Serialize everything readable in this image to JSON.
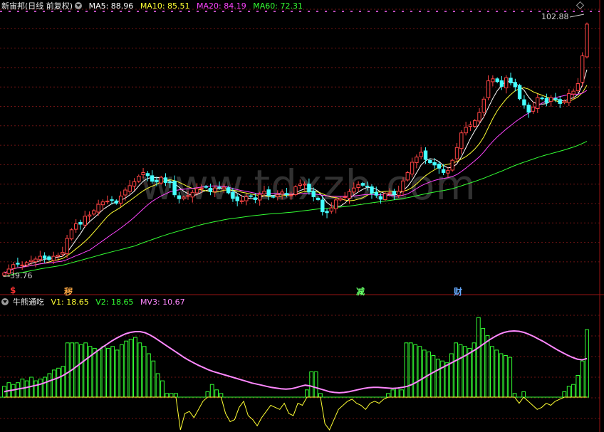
{
  "upper_header": {
    "title": "新宙邦(日线 前复权)",
    "ma_items": [
      {
        "label": "MA5: 88.96",
        "color": "#ffffff"
      },
      {
        "label": "MA10: 85.51",
        "color": "#ffff33"
      },
      {
        "label": "MA20: 84.19",
        "color": "#ff44ff"
      },
      {
        "label": "MA60: 72.31",
        "color": "#33ff33"
      }
    ]
  },
  "lower_header": {
    "title": "牛熊通吃",
    "items": [
      {
        "label": "V1: 18.65",
        "color": "#ffff33"
      },
      {
        "label": "V2: 18.65",
        "color": "#33ff33"
      },
      {
        "label": "MV3: 10.67",
        "color": "#ff88ff"
      }
    ]
  },
  "price_labels": {
    "high": "102.88",
    "low": "39.76"
  },
  "signals": [
    {
      "text": "$",
      "color": "#ff3333"
    },
    {
      "text": "秽",
      "color": "#ffaa44"
    },
    {
      "text": "减",
      "color": "#66ff66"
    },
    {
      "text": "财",
      "color": "#66aaff"
    }
  ],
  "watermark": "www.tdxzb.com",
  "chart_data": [
    {
      "type": "candlestick",
      "title": "新宙邦(日线 前复权)",
      "price_range": [
        39.76,
        102.88
      ],
      "closes": [
        40.2,
        41.2,
        42.3,
        42.4,
        42.2,
        42.8,
        43.4,
        43.7,
        44.4,
        43.9,
        43.6,
        44.4,
        44.7,
        45.4,
        48.9,
        51.1,
        52.6,
        52.5,
        54.5,
        54.8,
        55.9,
        57.5,
        58.1,
        58.3,
        58.6,
        57.8,
        59.6,
        61.1,
        62.2,
        63.2,
        64.6,
        65.5,
        64.7,
        63.3,
        63.2,
        64.3,
        63.0,
        63.0,
        59.9,
        58.9,
        59.3,
        59.7,
        60.5,
        61.4,
        61.6,
        61.8,
        60.7,
        61.6,
        61.8,
        61.8,
        60.4,
        59.0,
        58.4,
        58.4,
        59.4,
        59.5,
        58.7,
        60.0,
        60.8,
        59.7,
        59.4,
        59.9,
        60.6,
        59.9,
        59.8,
        61.9,
        62.6,
        62.6,
        60.6,
        59.4,
        58.7,
        55.6,
        55.4,
        56.6,
        58.6,
        59.0,
        59.4,
        60.7,
        61.6,
        62.4,
        62.3,
        61.9,
        60.3,
        59.8,
        58.8,
        60.2,
        60.4,
        60.0,
        60.8,
        63.4,
        65.5,
        68.1,
        69.4,
        70.6,
        68.8,
        68.0,
        67.4,
        66.6,
        65.5,
        66.0,
        68.6,
        71.8,
        75.5,
        76.9,
        77.5,
        78.6,
        80.6,
        84.0,
        88.6,
        89.1,
        88.4,
        87.2,
        89.4,
        88.1,
        87.1,
        84.1,
        82.5,
        80.7,
        82.0,
        84.4,
        84.1,
        83.1,
        84.4,
        83.9,
        82.9,
        83.5,
        85.4,
        86.0,
        87.9,
        94.9,
        102.9
      ],
      "ma": [
        {
          "name": "MA5",
          "value": 88.96
        },
        {
          "name": "MA10",
          "value": 85.51
        },
        {
          "name": "MA20",
          "value": 84.19
        },
        {
          "name": "MA60",
          "value": 72.31
        }
      ]
    },
    {
      "type": "bar+line",
      "title": "牛熊通吃",
      "y_range": [
        -8,
        24
      ],
      "bars": [
        3.0,
        4.0,
        3.5,
        4.0,
        5.0,
        4.5,
        5.5,
        4.5,
        5.0,
        5.5,
        6.5,
        7.5,
        8.0,
        8.5,
        15.0,
        15.0,
        15.0,
        14.5,
        15.0,
        14.0,
        13.5,
        13.0,
        14.0,
        13.5,
        14.0,
        13.0,
        14.5,
        15.5,
        16.0,
        16.5,
        15.0,
        14.0,
        12.0,
        10.0,
        6.5,
        4.5,
        1.0,
        1.0,
        1.0,
        -8.0,
        -4.0,
        -3.5,
        -5.0,
        -3.0,
        -1.0,
        1.5,
        3.5,
        2.0,
        1.0,
        -4.0,
        -6.0,
        -5.5,
        -2.5,
        -1.0,
        -4.5,
        -5.5,
        -7.0,
        -5.0,
        -3.5,
        -2.0,
        -2.5,
        -3.0,
        -1.5,
        -4.0,
        -4.5,
        -1.5,
        -2.0,
        2.0,
        7.0,
        7.0,
        1.0,
        -6.5,
        -8.0,
        -5.5,
        -3.0,
        -2.0,
        -1.0,
        -0.5,
        -1.5,
        -2.0,
        -3.0,
        -1.5,
        -1.0,
        -1.5,
        -0.5,
        1.0,
        2.0,
        2.5,
        2.0,
        15.0,
        15.0,
        14.5,
        14.0,
        13.0,
        12.5,
        11.5,
        10.5,
        10.0,
        9.5,
        12.0,
        15.0,
        14.5,
        14.0,
        13.5,
        15.0,
        22.0,
        19.0,
        17.0,
        14.0,
        13.0,
        12.0,
        11.5,
        11.0,
        1.0,
        -1.5,
        1.5,
        -1.0,
        -2.0,
        -3.0,
        -2.5,
        -1.5,
        -2.0,
        -1.0,
        -0.5,
        1.5,
        3.0,
        3.5,
        6.0,
        10.0,
        18.65
      ],
      "mv3": [
        1.5,
        1.8,
        2.0,
        2.3,
        2.5,
        2.8,
        3.1,
        3.4,
        3.8,
        4.3,
        4.8,
        5.3,
        5.9,
        6.7,
        7.6,
        8.6,
        9.6,
        10.6,
        11.6,
        12.6,
        13.6,
        14.5,
        15.4,
        16.2,
        16.9,
        17.5,
        17.9,
        18.1,
        18.1,
        17.8,
        17.2,
        16.4,
        15.5,
        14.6,
        13.7,
        12.8,
        11.9,
        11.0,
        10.2,
        9.5,
        8.8,
        8.2,
        7.6,
        7.1,
        6.7,
        6.3,
        5.9,
        5.5,
        5.1,
        4.7,
        4.3,
        3.9,
        3.6,
        3.3,
        3.0,
        2.7,
        2.5,
        2.3,
        2.2,
        2.3,
        2.6,
        3.0,
        3.3,
        3.1,
        2.7,
        2.3,
        1.9,
        1.5,
        1.3,
        1.2,
        1.3,
        1.5,
        1.8,
        2.1,
        2.4,
        2.6,
        2.7,
        2.7,
        2.6,
        2.5,
        2.4,
        2.5,
        2.7,
        3.0,
        3.5,
        4.2,
        5.0,
        5.8,
        6.6,
        7.3,
        8.0,
        8.7,
        9.4,
        10.1,
        10.8,
        11.5,
        12.3,
        13.1,
        14.0,
        15.0,
        15.9,
        16.7,
        17.4,
        17.9,
        18.2,
        18.3,
        18.2,
        17.9,
        17.4,
        16.8,
        16.1,
        15.4,
        14.6,
        13.8,
        13.0,
        12.3,
        11.6,
        11.0,
        10.5,
        10.3,
        10.67
      ]
    }
  ]
}
